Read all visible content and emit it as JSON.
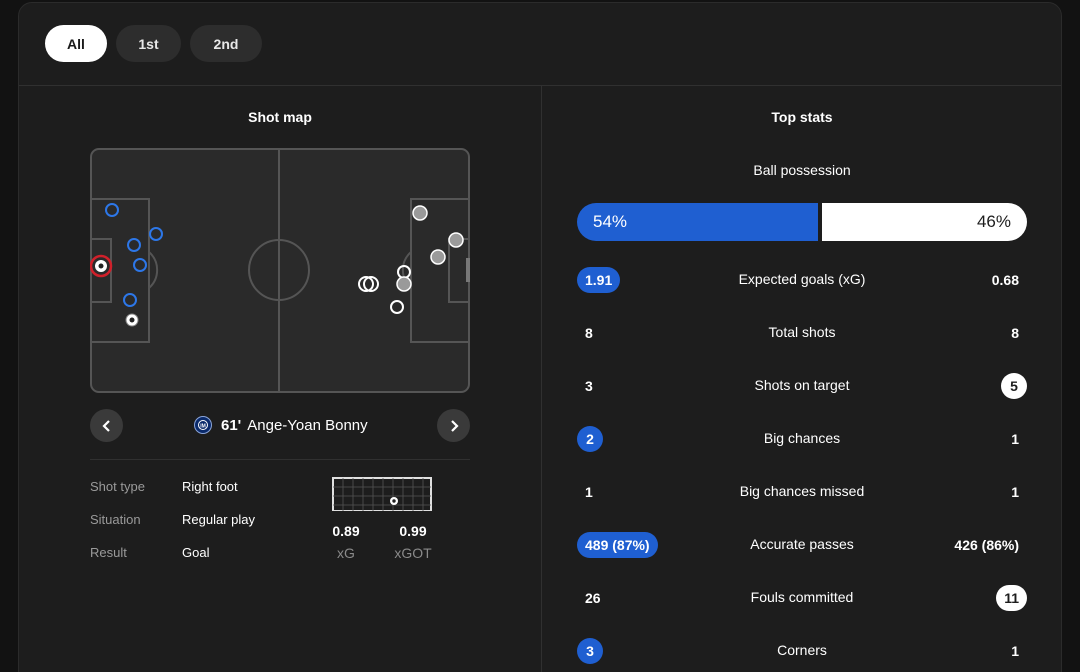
{
  "period_tabs": [
    {
      "label": "All",
      "active": true
    },
    {
      "label": "1st",
      "active": false
    },
    {
      "label": "2nd",
      "active": false
    }
  ],
  "shot_map": {
    "title": "Shot map",
    "selected_shot": {
      "minute": "61'",
      "player": "Ange-Yoan Bonny",
      "details": [
        {
          "label": "Shot type",
          "value": "Right foot"
        },
        {
          "label": "Situation",
          "value": "Regular play"
        },
        {
          "label": "Result",
          "value": "Goal"
        }
      ],
      "xg": {
        "value": "0.89",
        "label": "xG"
      },
      "xgot": {
        "value": "0.99",
        "label": "xGOT"
      }
    }
  },
  "top_stats": {
    "title": "Top stats",
    "possession": {
      "label": "Ball possession",
      "home": "54%",
      "away": "46%",
      "home_fraction": 0.54
    },
    "rows": [
      {
        "label": "Expected goals (xG)",
        "home": "1.91",
        "away": "0.68",
        "highlight": "home"
      },
      {
        "label": "Total shots",
        "home": "8",
        "away": "8",
        "highlight": "none"
      },
      {
        "label": "Shots on target",
        "home": "3",
        "away": "5",
        "highlight": "away"
      },
      {
        "label": "Big chances",
        "home": "2",
        "away": "1",
        "highlight": "home"
      },
      {
        "label": "Big chances missed",
        "home": "1",
        "away": "1",
        "highlight": "none"
      },
      {
        "label": "Accurate passes",
        "home": "489 (87%)",
        "away": "426 (86%)",
        "highlight": "home"
      },
      {
        "label": "Fouls committed",
        "home": "26",
        "away": "11",
        "highlight": "away"
      },
      {
        "label": "Corners",
        "home": "3",
        "away": "1",
        "highlight": "home"
      }
    ]
  },
  "colors": {
    "home_accent": "#1f5fd1",
    "away_accent": "#ffffff",
    "goal_marker_ring": "#d0202a"
  },
  "icons": {
    "prev": "chevron-left-icon",
    "next": "chevron-right-icon",
    "team": "inter-badge-icon",
    "goal": "football-icon"
  }
}
